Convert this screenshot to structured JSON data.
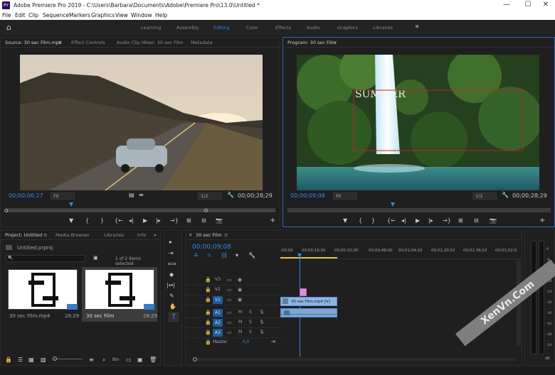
{
  "window": {
    "title": "Adobe Premiere Pro 2019 - C:\\Users\\Barbara\\Documents\\Adobe\\Premiere Pro\\13.0\\Untitled *",
    "app_badge": "Pr",
    "minimize": "—",
    "maximize": "☐",
    "close": "✕"
  },
  "menu": [
    "File",
    "Edit",
    "Clip",
    "Sequence",
    "Markers",
    "Graphics",
    "View",
    "Window",
    "Help"
  ],
  "workspaces": {
    "home": "⌂",
    "items": [
      "Learning",
      "Assembly",
      "Editing",
      "Color",
      "Effects",
      "Audio",
      "Graphics",
      "Libraries"
    ],
    "active": "Editing",
    "more": "»"
  },
  "source": {
    "tabs": [
      "Source: 30 sec Film.mp4",
      "Effect Controls",
      "Audio Clip Mixer: 30 sec Film",
      "Metadata"
    ],
    "menu": "≡",
    "timecode": "00;00;06;27",
    "fit": "Fit",
    "resolution": "1/2",
    "duration": "00;00;28;29",
    "playhead_fraction": 0.24,
    "wrench": "🔧"
  },
  "program": {
    "tab": "Program: 30 sec Film",
    "menu": "≡",
    "overlay_text": "SUMMER",
    "timecode": "00;00;09;08",
    "fit": "Fit",
    "resolution": "1/2",
    "duration": "00;00;28;29",
    "playhead_fraction": 0.4,
    "wrench": "🔧"
  },
  "controls": {
    "marker": "▼",
    "in": "{",
    "out": "}",
    "goto_in": "{←",
    "step_back": "◂|",
    "play": "▶",
    "step_fwd": "|▸",
    "goto_out": "→}",
    "insert": "⊞",
    "overwrite": "⊟",
    "export": "📷",
    "add": "+"
  },
  "project": {
    "tabs": [
      "Project: Untitled",
      "Media Browser",
      "Libraries",
      "Info"
    ],
    "menu": "≡",
    "more": "»",
    "filename": "Untitled.prproj",
    "search_placeholder": "🔍",
    "items_selected": "1 of 2 items selected",
    "items": [
      {
        "name": "30 sec Film.mp4",
        "duration": "28;29"
      },
      {
        "name": "30 sec Film",
        "duration": "28;29"
      }
    ],
    "bin": "Bin"
  },
  "tools": [
    "▸",
    "⇥",
    "⟺",
    "◆",
    "|↔|",
    "✎",
    "✋",
    "T"
  ],
  "timeline": {
    "tab": "30 sec Film",
    "menu": "≡",
    "close": "✕",
    "timecode": "00;00;09;08",
    "ruler_labels": [
      ":00;00",
      "00;00;16;00",
      "00;00;32;00",
      "00;00;48;00",
      "00;01;04;02",
      "00;01;20;02",
      "00;01;36;02",
      "00;01;52;0"
    ],
    "playhead_fraction": 0.08,
    "video_tracks": [
      "V3",
      "V2",
      "V1"
    ],
    "audio_tracks": [
      "A1",
      "A2",
      "A3"
    ],
    "master": "Master",
    "master_value": "0,0",
    "clip_video": "30 sec Film.mp4 [V]",
    "mute": "M",
    "solo": "S",
    "eye": "◉",
    "lock": "🔒",
    "record": "🎙"
  },
  "meter": {
    "labels": [
      "0",
      "-6",
      "-12",
      "-18",
      "-24",
      "-30",
      "-36",
      "-42",
      "-48",
      "-54"
    ],
    "db": "dB"
  },
  "watermark": "XenVn.Com"
}
